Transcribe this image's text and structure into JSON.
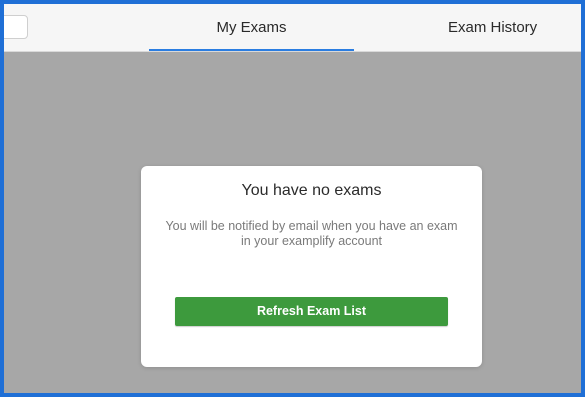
{
  "tabs": {
    "my_exams": "My Exams",
    "exam_history": "Exam History"
  },
  "modal": {
    "title": "You have no exams",
    "message": "You will be notified by email when you have an exam in your examplify account",
    "refresh_button": "Refresh Exam List"
  },
  "colors": {
    "border": "#1f6fd6",
    "overlay": "#a7a7a7",
    "tab_underline": "#2a7de1",
    "button": "#3d9a3d"
  }
}
